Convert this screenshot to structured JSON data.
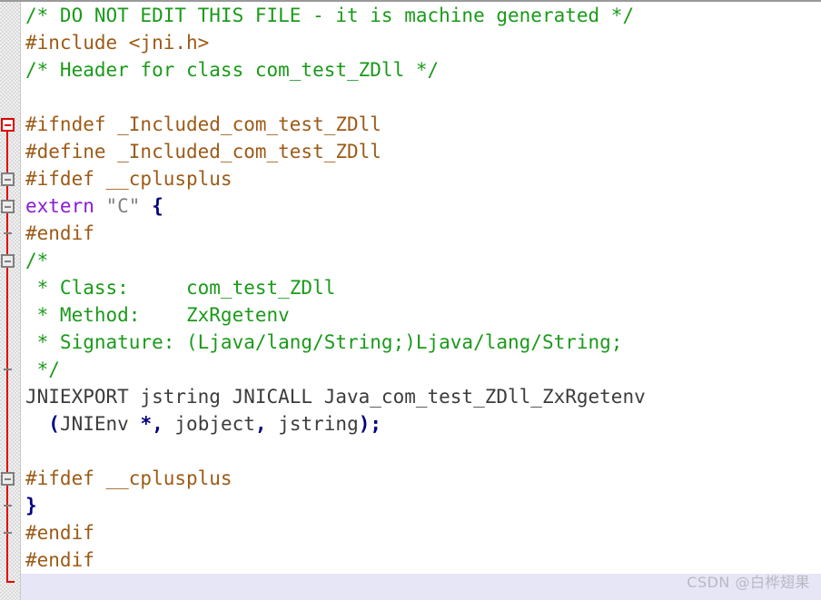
{
  "editor": {
    "language": "c-header",
    "colors": {
      "background": "#ffffff",
      "gutter": "#f1f1f1",
      "fold_rail": "#e00000",
      "fold_box_border": "#808080",
      "comment": "#1a9a1a",
      "preprocessor": "#9d5a16",
      "keyword": "#8b1ad6",
      "string": "#808080",
      "punctuation": "#000080",
      "plain_text": "#3c3c3c",
      "current_line": "#e6e6f7",
      "watermark": "#b9b9c4"
    },
    "lines": [
      {
        "n": 1,
        "text": "/* DO NOT EDIT THIS FILE - it is machine generated */"
      },
      {
        "n": 2,
        "text": "#include <jni.h>"
      },
      {
        "n": 3,
        "text": "/* Header for class com_test_ZDll */"
      },
      {
        "n": 4,
        "text": ""
      },
      {
        "n": 5,
        "text": "#ifndef _Included_com_test_ZDll"
      },
      {
        "n": 6,
        "text": "#define _Included_com_test_ZDll"
      },
      {
        "n": 7,
        "text": "#ifdef __cplusplus"
      },
      {
        "n": 8,
        "text": "extern \"C\" {"
      },
      {
        "n": 9,
        "text": "#endif"
      },
      {
        "n": 10,
        "text": "/*"
      },
      {
        "n": 11,
        "text": " * Class:     com_test_ZDll"
      },
      {
        "n": 12,
        "text": " * Method:    ZxRgetenv"
      },
      {
        "n": 13,
        "text": " * Signature: (Ljava/lang/String;)Ljava/lang/String;"
      },
      {
        "n": 14,
        "text": " */"
      },
      {
        "n": 15,
        "text": "JNIEXPORT jstring JNICALL Java_com_test_ZDll_ZxRgetenv"
      },
      {
        "n": 16,
        "text": "  (JNIEnv *, jobject, jstring);"
      },
      {
        "n": 17,
        "text": ""
      },
      {
        "n": 18,
        "text": "#ifdef __cplusplus"
      },
      {
        "n": 19,
        "text": "}"
      },
      {
        "n": 20,
        "text": "#endif"
      },
      {
        "n": 21,
        "text": "#endif"
      },
      {
        "n": 22,
        "text": ""
      }
    ],
    "line_tokens": {
      "l1": [
        {
          "t": "/* DO NOT EDIT THIS FILE - it is machine generated */",
          "c": "comment"
        }
      ],
      "l2": [
        {
          "t": "#include <jni.h>",
          "c": "preproc"
        }
      ],
      "l3": [
        {
          "t": "/* Header for class com_test_ZDll */",
          "c": "comment"
        }
      ],
      "l5": [
        {
          "t": "#ifndef _Included_com_test_ZDll",
          "c": "preproc"
        }
      ],
      "l6": [
        {
          "t": "#define _Included_com_test_ZDll",
          "c": "preproc"
        }
      ],
      "l7": [
        {
          "t": "#ifdef __cplusplus",
          "c": "preproc"
        }
      ],
      "l8": [
        {
          "t": "extern",
          "c": "keyword"
        },
        {
          "t": " ",
          "c": "plain"
        },
        {
          "t": "\"C\"",
          "c": "string"
        },
        {
          "t": " ",
          "c": "plain"
        },
        {
          "t": "{",
          "c": "punct"
        }
      ],
      "l9": [
        {
          "t": "#endif",
          "c": "preproc"
        }
      ],
      "l10": [
        {
          "t": "/*",
          "c": "comment"
        }
      ],
      "l11": [
        {
          "t": " * Class:     com_test_ZDll",
          "c": "comment"
        }
      ],
      "l12": [
        {
          "t": " * Method:    ZxRgetenv",
          "c": "comment"
        }
      ],
      "l13": [
        {
          "t": " * Signature: (Ljava/lang/String;)Ljava/lang/String;",
          "c": "comment"
        }
      ],
      "l14": [
        {
          "t": " */",
          "c": "comment"
        }
      ],
      "l15": [
        {
          "t": "JNIEXPORT jstring JNICALL Java_com_test_ZDll_ZxRgetenv",
          "c": "plain"
        }
      ],
      "l16": [
        {
          "t": "  ",
          "c": "plain"
        },
        {
          "t": "(",
          "c": "punct"
        },
        {
          "t": "JNIEnv ",
          "c": "plain"
        },
        {
          "t": "*,",
          "c": "punct"
        },
        {
          "t": " jobject",
          "c": "plain"
        },
        {
          "t": ",",
          "c": "punct"
        },
        {
          "t": " jstring",
          "c": "plain"
        },
        {
          "t": ")",
          "c": "punct"
        },
        {
          "t": ";",
          "c": "punct"
        }
      ],
      "l18": [
        {
          "t": "#ifdef __cplusplus",
          "c": "preproc"
        }
      ],
      "l19": [
        {
          "t": "}",
          "c": "punct"
        }
      ],
      "l20": [
        {
          "t": "#endif",
          "c": "preproc"
        }
      ],
      "l21": [
        {
          "t": "#endif",
          "c": "preproc"
        }
      ]
    },
    "fold_markers": [
      {
        "id": "fold-ifndef",
        "line": 5,
        "state": "expanded",
        "style": "root"
      },
      {
        "id": "fold-ifdef-1",
        "line": 7,
        "state": "expanded",
        "style": "normal"
      },
      {
        "id": "fold-extern",
        "line": 8,
        "state": "expanded",
        "style": "normal"
      },
      {
        "id": "fold-comment",
        "line": 10,
        "state": "expanded",
        "style": "normal"
      },
      {
        "id": "fold-ifdef-2",
        "line": 18,
        "state": "expanded",
        "style": "normal"
      }
    ]
  },
  "watermark": {
    "text": "CSDN @白桦翅果"
  }
}
